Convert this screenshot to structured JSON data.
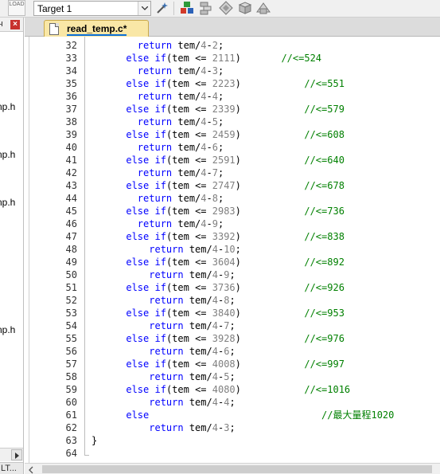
{
  "toolbar": {
    "load_text": "LOAD",
    "target_label": "Target 1",
    "icons": [
      "load-icon",
      "options-wand-icon",
      "manage-components-icon",
      "file-extensions-icon",
      "select-packs-icon",
      "pack-installer-icon",
      "manage-run-icon"
    ]
  },
  "project_pane": {
    "files": [
      "np.h",
      "np.h",
      "np.h",
      "np.h"
    ],
    "bottom_tab": "LT..."
  },
  "editor": {
    "tab_label": "read_temp.c*",
    "lines": [
      {
        "n": "32",
        "segs": [
          {
            "t": "        ",
            "c": ""
          },
          {
            "t": "return",
            "c": "kw"
          },
          {
            "t": " tem/",
            "c": ""
          },
          {
            "t": "4",
            "c": "num"
          },
          {
            "t": "-",
            "c": ""
          },
          {
            "t": "2",
            "c": "num"
          },
          {
            "t": ";",
            "c": ""
          }
        ]
      },
      {
        "n": "33",
        "segs": [
          {
            "t": "      ",
            "c": ""
          },
          {
            "t": "else",
            "c": "kw"
          },
          {
            "t": " ",
            "c": ""
          },
          {
            "t": "if",
            "c": "kw"
          },
          {
            "t": "(tem <= ",
            "c": ""
          },
          {
            "t": "2111",
            "c": "num"
          },
          {
            "t": ")       ",
            "c": ""
          },
          {
            "t": "//<=524",
            "c": "cmt"
          }
        ]
      },
      {
        "n": "34",
        "segs": [
          {
            "t": "        ",
            "c": ""
          },
          {
            "t": "return",
            "c": "kw"
          },
          {
            "t": " tem/",
            "c": ""
          },
          {
            "t": "4",
            "c": "num"
          },
          {
            "t": "-",
            "c": ""
          },
          {
            "t": "3",
            "c": "num"
          },
          {
            "t": ";",
            "c": ""
          }
        ]
      },
      {
        "n": "35",
        "segs": [
          {
            "t": "      ",
            "c": ""
          },
          {
            "t": "else",
            "c": "kw"
          },
          {
            "t": " ",
            "c": ""
          },
          {
            "t": "if",
            "c": "kw"
          },
          {
            "t": "(tem <= ",
            "c": ""
          },
          {
            "t": "2223",
            "c": "num"
          },
          {
            "t": ")           ",
            "c": ""
          },
          {
            "t": "//<=551",
            "c": "cmt"
          }
        ]
      },
      {
        "n": "36",
        "segs": [
          {
            "t": "        ",
            "c": ""
          },
          {
            "t": "return",
            "c": "kw"
          },
          {
            "t": " tem/",
            "c": ""
          },
          {
            "t": "4",
            "c": "num"
          },
          {
            "t": "-",
            "c": ""
          },
          {
            "t": "4",
            "c": "num"
          },
          {
            "t": ";",
            "c": ""
          }
        ]
      },
      {
        "n": "37",
        "segs": [
          {
            "t": "      ",
            "c": ""
          },
          {
            "t": "else",
            "c": "kw"
          },
          {
            "t": " ",
            "c": ""
          },
          {
            "t": "if",
            "c": "kw"
          },
          {
            "t": "(tem <= ",
            "c": ""
          },
          {
            "t": "2339",
            "c": "num"
          },
          {
            "t": ")           ",
            "c": ""
          },
          {
            "t": "//<=579",
            "c": "cmt"
          }
        ]
      },
      {
        "n": "38",
        "segs": [
          {
            "t": "        ",
            "c": ""
          },
          {
            "t": "return",
            "c": "kw"
          },
          {
            "t": " tem/",
            "c": ""
          },
          {
            "t": "4",
            "c": "num"
          },
          {
            "t": "-",
            "c": ""
          },
          {
            "t": "5",
            "c": "num"
          },
          {
            "t": ";",
            "c": ""
          }
        ]
      },
      {
        "n": "39",
        "segs": [
          {
            "t": "      ",
            "c": ""
          },
          {
            "t": "else",
            "c": "kw"
          },
          {
            "t": " ",
            "c": ""
          },
          {
            "t": "if",
            "c": "kw"
          },
          {
            "t": "(tem <= ",
            "c": ""
          },
          {
            "t": "2459",
            "c": "num"
          },
          {
            "t": ")           ",
            "c": ""
          },
          {
            "t": "//<=608",
            "c": "cmt"
          }
        ]
      },
      {
        "n": "40",
        "segs": [
          {
            "t": "        ",
            "c": ""
          },
          {
            "t": "return",
            "c": "kw"
          },
          {
            "t": " tem/",
            "c": ""
          },
          {
            "t": "4",
            "c": "num"
          },
          {
            "t": "-",
            "c": ""
          },
          {
            "t": "6",
            "c": "num"
          },
          {
            "t": ";",
            "c": ""
          }
        ]
      },
      {
        "n": "41",
        "segs": [
          {
            "t": "      ",
            "c": ""
          },
          {
            "t": "else",
            "c": "kw"
          },
          {
            "t": " ",
            "c": ""
          },
          {
            "t": "if",
            "c": "kw"
          },
          {
            "t": "(tem <= ",
            "c": ""
          },
          {
            "t": "2591",
            "c": "num"
          },
          {
            "t": ")           ",
            "c": ""
          },
          {
            "t": "//<=640",
            "c": "cmt"
          }
        ]
      },
      {
        "n": "42",
        "segs": [
          {
            "t": "        ",
            "c": ""
          },
          {
            "t": "return",
            "c": "kw"
          },
          {
            "t": " tem/",
            "c": ""
          },
          {
            "t": "4",
            "c": "num"
          },
          {
            "t": "-",
            "c": ""
          },
          {
            "t": "7",
            "c": "num"
          },
          {
            "t": ";",
            "c": ""
          }
        ]
      },
      {
        "n": "43",
        "segs": [
          {
            "t": "      ",
            "c": ""
          },
          {
            "t": "else",
            "c": "kw"
          },
          {
            "t": " ",
            "c": ""
          },
          {
            "t": "if",
            "c": "kw"
          },
          {
            "t": "(tem <= ",
            "c": ""
          },
          {
            "t": "2747",
            "c": "num"
          },
          {
            "t": ")           ",
            "c": ""
          },
          {
            "t": "//<=678",
            "c": "cmt"
          }
        ]
      },
      {
        "n": "44",
        "segs": [
          {
            "t": "        ",
            "c": ""
          },
          {
            "t": "return",
            "c": "kw"
          },
          {
            "t": " tem/",
            "c": ""
          },
          {
            "t": "4",
            "c": "num"
          },
          {
            "t": "-",
            "c": ""
          },
          {
            "t": "8",
            "c": "num"
          },
          {
            "t": ";",
            "c": ""
          }
        ]
      },
      {
        "n": "45",
        "segs": [
          {
            "t": "      ",
            "c": ""
          },
          {
            "t": "else",
            "c": "kw"
          },
          {
            "t": " ",
            "c": ""
          },
          {
            "t": "if",
            "c": "kw"
          },
          {
            "t": "(tem <= ",
            "c": ""
          },
          {
            "t": "2983",
            "c": "num"
          },
          {
            "t": ")           ",
            "c": ""
          },
          {
            "t": "//<=736",
            "c": "cmt"
          }
        ]
      },
      {
        "n": "46",
        "segs": [
          {
            "t": "        ",
            "c": ""
          },
          {
            "t": "return",
            "c": "kw"
          },
          {
            "t": " tem/",
            "c": ""
          },
          {
            "t": "4",
            "c": "num"
          },
          {
            "t": "-",
            "c": ""
          },
          {
            "t": "9",
            "c": "num"
          },
          {
            "t": ";",
            "c": ""
          }
        ]
      },
      {
        "n": "47",
        "segs": [
          {
            "t": "      ",
            "c": ""
          },
          {
            "t": "else",
            "c": "kw"
          },
          {
            "t": " ",
            "c": ""
          },
          {
            "t": "if",
            "c": "kw"
          },
          {
            "t": "(tem <= ",
            "c": ""
          },
          {
            "t": "3392",
            "c": "num"
          },
          {
            "t": ")           ",
            "c": ""
          },
          {
            "t": "//<=838",
            "c": "cmt"
          }
        ]
      },
      {
        "n": "48",
        "segs": [
          {
            "t": "          ",
            "c": ""
          },
          {
            "t": "return",
            "c": "kw"
          },
          {
            "t": " tem/",
            "c": ""
          },
          {
            "t": "4",
            "c": "num"
          },
          {
            "t": "-",
            "c": ""
          },
          {
            "t": "10",
            "c": "num"
          },
          {
            "t": ";",
            "c": ""
          }
        ]
      },
      {
        "n": "49",
        "segs": [
          {
            "t": "      ",
            "c": ""
          },
          {
            "t": "else",
            "c": "kw"
          },
          {
            "t": " ",
            "c": ""
          },
          {
            "t": "if",
            "c": "kw"
          },
          {
            "t": "(tem <= ",
            "c": ""
          },
          {
            "t": "3604",
            "c": "num"
          },
          {
            "t": ")           ",
            "c": ""
          },
          {
            "t": "//<=892",
            "c": "cmt"
          }
        ]
      },
      {
        "n": "50",
        "segs": [
          {
            "t": "          ",
            "c": ""
          },
          {
            "t": "return",
            "c": "kw"
          },
          {
            "t": " tem/",
            "c": ""
          },
          {
            "t": "4",
            "c": "num"
          },
          {
            "t": "-",
            "c": ""
          },
          {
            "t": "9",
            "c": "num"
          },
          {
            "t": ";",
            "c": ""
          }
        ]
      },
      {
        "n": "51",
        "segs": [
          {
            "t": "      ",
            "c": ""
          },
          {
            "t": "else",
            "c": "kw"
          },
          {
            "t": " ",
            "c": ""
          },
          {
            "t": "if",
            "c": "kw"
          },
          {
            "t": "(tem <= ",
            "c": ""
          },
          {
            "t": "3736",
            "c": "num"
          },
          {
            "t": ")           ",
            "c": ""
          },
          {
            "t": "//<=926",
            "c": "cmt"
          }
        ]
      },
      {
        "n": "52",
        "segs": [
          {
            "t": "          ",
            "c": ""
          },
          {
            "t": "return",
            "c": "kw"
          },
          {
            "t": " tem/",
            "c": ""
          },
          {
            "t": "4",
            "c": "num"
          },
          {
            "t": "-",
            "c": ""
          },
          {
            "t": "8",
            "c": "num"
          },
          {
            "t": ";",
            "c": ""
          }
        ]
      },
      {
        "n": "53",
        "segs": [
          {
            "t": "      ",
            "c": ""
          },
          {
            "t": "else",
            "c": "kw"
          },
          {
            "t": " ",
            "c": ""
          },
          {
            "t": "if",
            "c": "kw"
          },
          {
            "t": "(tem <= ",
            "c": ""
          },
          {
            "t": "3840",
            "c": "num"
          },
          {
            "t": ")           ",
            "c": ""
          },
          {
            "t": "//<=953",
            "c": "cmt"
          }
        ]
      },
      {
        "n": "54",
        "segs": [
          {
            "t": "          ",
            "c": ""
          },
          {
            "t": "return",
            "c": "kw"
          },
          {
            "t": " tem/",
            "c": ""
          },
          {
            "t": "4",
            "c": "num"
          },
          {
            "t": "-",
            "c": ""
          },
          {
            "t": "7",
            "c": "num"
          },
          {
            "t": ";",
            "c": ""
          }
        ]
      },
      {
        "n": "55",
        "segs": [
          {
            "t": "      ",
            "c": ""
          },
          {
            "t": "else",
            "c": "kw"
          },
          {
            "t": " ",
            "c": ""
          },
          {
            "t": "if",
            "c": "kw"
          },
          {
            "t": "(tem <= ",
            "c": ""
          },
          {
            "t": "3928",
            "c": "num"
          },
          {
            "t": ")           ",
            "c": ""
          },
          {
            "t": "//<=976",
            "c": "cmt"
          }
        ]
      },
      {
        "n": "56",
        "segs": [
          {
            "t": "          ",
            "c": ""
          },
          {
            "t": "return",
            "c": "kw"
          },
          {
            "t": " tem/",
            "c": ""
          },
          {
            "t": "4",
            "c": "num"
          },
          {
            "t": "-",
            "c": ""
          },
          {
            "t": "6",
            "c": "num"
          },
          {
            "t": ";",
            "c": ""
          }
        ]
      },
      {
        "n": "57",
        "segs": [
          {
            "t": "      ",
            "c": ""
          },
          {
            "t": "else",
            "c": "kw"
          },
          {
            "t": " ",
            "c": ""
          },
          {
            "t": "if",
            "c": "kw"
          },
          {
            "t": "(tem <= ",
            "c": ""
          },
          {
            "t": "4008",
            "c": "num"
          },
          {
            "t": ")           ",
            "c": ""
          },
          {
            "t": "//<=997",
            "c": "cmt"
          }
        ]
      },
      {
        "n": "58",
        "segs": [
          {
            "t": "          ",
            "c": ""
          },
          {
            "t": "return",
            "c": "kw"
          },
          {
            "t": " tem/",
            "c": ""
          },
          {
            "t": "4",
            "c": "num"
          },
          {
            "t": "-",
            "c": ""
          },
          {
            "t": "5",
            "c": "num"
          },
          {
            "t": ";",
            "c": ""
          }
        ]
      },
      {
        "n": "59",
        "segs": [
          {
            "t": "      ",
            "c": ""
          },
          {
            "t": "else",
            "c": "kw"
          },
          {
            "t": " ",
            "c": ""
          },
          {
            "t": "if",
            "c": "kw"
          },
          {
            "t": "(tem <= ",
            "c": ""
          },
          {
            "t": "4080",
            "c": "num"
          },
          {
            "t": ")           ",
            "c": ""
          },
          {
            "t": "//<=1016",
            "c": "cmt"
          }
        ]
      },
      {
        "n": "60",
        "segs": [
          {
            "t": "          ",
            "c": ""
          },
          {
            "t": "return",
            "c": "kw"
          },
          {
            "t": " tem/",
            "c": ""
          },
          {
            "t": "4",
            "c": "num"
          },
          {
            "t": "-",
            "c": ""
          },
          {
            "t": "4",
            "c": "num"
          },
          {
            "t": ";",
            "c": ""
          }
        ]
      },
      {
        "n": "61",
        "segs": [
          {
            "t": "      ",
            "c": ""
          },
          {
            "t": "else",
            "c": "kw"
          },
          {
            "t": "                              ",
            "c": ""
          },
          {
            "t": "//最大量程1020",
            "c": "cmt"
          }
        ]
      },
      {
        "n": "62",
        "segs": [
          {
            "t": "          ",
            "c": ""
          },
          {
            "t": "return",
            "c": "kw"
          },
          {
            "t": " tem/",
            "c": ""
          },
          {
            "t": "4",
            "c": "num"
          },
          {
            "t": "-",
            "c": ""
          },
          {
            "t": "3",
            "c": "num"
          },
          {
            "t": ";",
            "c": ""
          }
        ]
      },
      {
        "n": "63",
        "segs": [
          {
            "t": "}",
            "c": ""
          }
        ]
      },
      {
        "n": "64",
        "segs": []
      }
    ]
  },
  "colors": {
    "keyword": "#0000ff",
    "number": "#7f7f7f",
    "comment": "#008000",
    "tab_active": "#f9e7a6"
  }
}
